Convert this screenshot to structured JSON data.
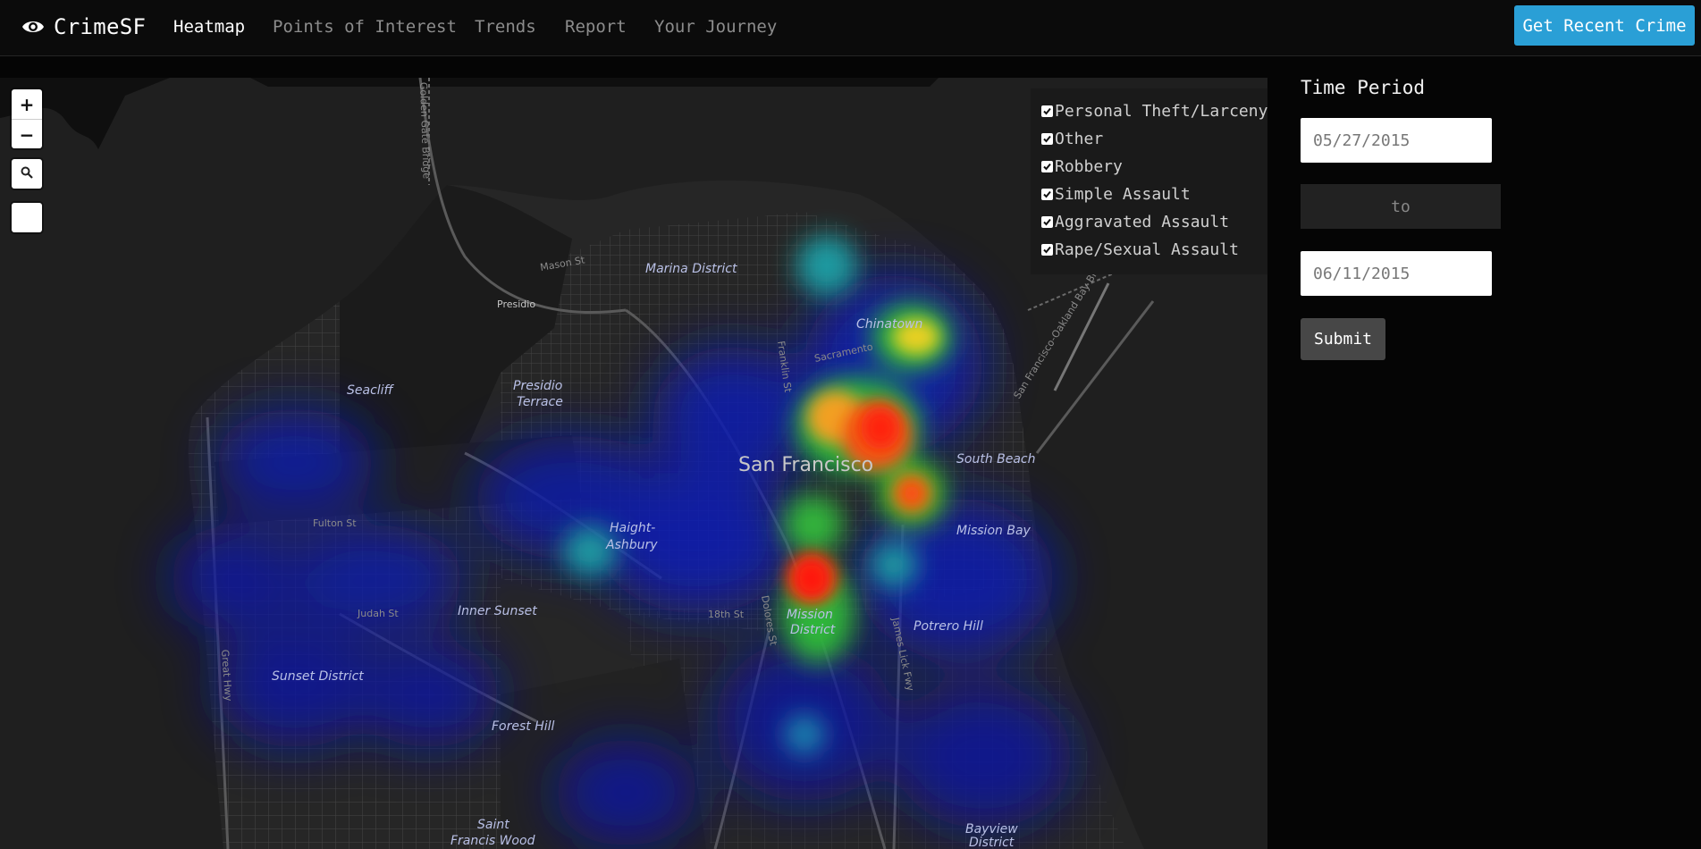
{
  "brand": {
    "name": "CrimeSF",
    "icon": "eye-icon"
  },
  "nav": {
    "items": [
      {
        "label": "Heatmap",
        "active": true
      },
      {
        "label": "Points of Interest",
        "active": false
      },
      {
        "label": "Trends",
        "active": false
      },
      {
        "label": "Report",
        "active": false
      },
      {
        "label": "Your Journey",
        "active": false
      }
    ],
    "cta_label": "Get Recent Crime"
  },
  "colors": {
    "accent": "#2a9fd6",
    "background": "#050505",
    "map_background": "#1e1e1e",
    "submit": "#474747"
  },
  "map": {
    "controls": {
      "zoom_in": "+",
      "zoom_out": "−",
      "search_icon": "search-icon"
    },
    "legend": [
      {
        "label": "Personal Theft/Larceny",
        "checked": true
      },
      {
        "label": "Other",
        "checked": true
      },
      {
        "label": "Robbery",
        "checked": true
      },
      {
        "label": "Simple Assault",
        "checked": true
      },
      {
        "label": "Aggravated Assault",
        "checked": true
      },
      {
        "label": "Rape/Sexual Assault",
        "checked": true
      }
    ],
    "labels": {
      "city": "San Francisco",
      "marina": "Marina District",
      "presidio": "Presidio",
      "presidio_terrace_1": "Presidio",
      "presidio_terrace_2": "Terrace",
      "seacliff": "Seacliff",
      "chinatown": "Chinatown",
      "south_beach": "South Beach",
      "mission_bay": "Mission Bay",
      "haight_1": "Haight-",
      "haight_2": "Ashbury",
      "inner_sunset": "Inner Sunset",
      "sunset_district": "Sunset District",
      "mission_1": "Mission",
      "mission_2": "District",
      "potrero_hill": "Potrero Hill",
      "forest_hill": "Forest Hill",
      "saint_francis_1": "Saint",
      "saint_francis_2": "Francis Wood",
      "bayview_1": "Bayview",
      "bayview_2": "District",
      "fulton_st": "Fulton St",
      "judah_st": "Judah St",
      "mason_st": "Mason St",
      "sacramento": "Sacramento",
      "eighteenth_st": "18th St",
      "dolores_st": "Dolores St",
      "golden_gate_bridge": "Golden Gate Bridge",
      "oakland_bay_bridge": "San Francisco-Oakland Bay Bridge",
      "great_hwy": "Great Hwy",
      "franklin_st": "Franklin St",
      "james_lick": "James Lick Fwy"
    }
  },
  "time_period": {
    "title": "Time Period",
    "start_date": "05/27/2015",
    "separator": "to",
    "end_date": "06/11/2015",
    "submit_label": "Submit"
  }
}
